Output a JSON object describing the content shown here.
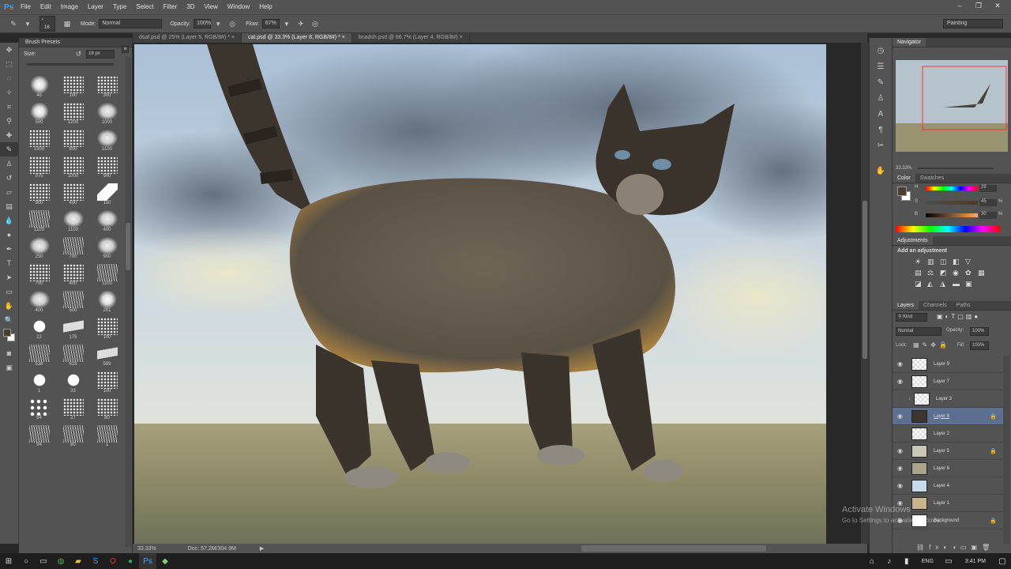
{
  "menu": {
    "logo": "Ps",
    "items": [
      "File",
      "Edit",
      "Image",
      "Layer",
      "Type",
      "Select",
      "Filter",
      "3D",
      "View",
      "Window",
      "Help"
    ]
  },
  "options": {
    "brush_size": "16",
    "mode_label": "Mode:",
    "mode_value": "Normal",
    "opacity_label": "Opacity:",
    "opacity_value": "100%",
    "flow_label": "Flow:",
    "flow_value": "67%",
    "workspace": "Painting"
  },
  "tabs": [
    {
      "label": "dsaf.psd @ 25% (Layer 5, RGB/8#) *"
    },
    {
      "label": "cat.psd @ 33.3% (Layer 8, RGB/8#) *"
    },
    {
      "label": "bnadsh.psd @ 66.7% (Layer 4, RGB/8#)"
    }
  ],
  "brush_presets": {
    "title": "Brush Presets",
    "size_label": "Size:",
    "size_value": "16 px",
    "sizes": [
      "48",
      "100",
      "300",
      "500",
      "1200",
      "1000",
      "1300",
      "800",
      "1100",
      "975",
      "1000",
      "900",
      "900",
      "400",
      "150",
      "1100",
      "1100",
      "400",
      "250",
      "700",
      "900",
      "700",
      "400",
      "1100",
      "400",
      "500",
      "201",
      "22",
      "175",
      "100",
      "538",
      "618",
      "589",
      "1",
      "33",
      "100",
      "54",
      "27",
      "80",
      "94",
      "80",
      "1"
    ]
  },
  "status": {
    "zoom": "33.33%",
    "doc": "Doc: 57.2M/304.9M"
  },
  "navigator": {
    "title": "Navigator",
    "zoom": "33.33%"
  },
  "color": {
    "tabs": [
      "Color",
      "Swatches"
    ],
    "h_label": "H",
    "h_value": "29",
    "s_label": "S",
    "s_value": "45",
    "b_label": "B",
    "b_value": "30",
    "percent": "%",
    "foreground": "#4a3e30",
    "background": "#ffffff"
  },
  "adjustments": {
    "tab": "Adjustments",
    "add_label": "Add an adjustment"
  },
  "layers_panel": {
    "tabs": [
      "Layers",
      "Channels",
      "Paths"
    ],
    "filter": "Kind",
    "blend": "Normal",
    "opacity_label": "Opacity:",
    "opacity_value": "100%",
    "lock_label": "Lock:",
    "fill_label": "Fill:",
    "fill_value": "100%",
    "layers": [
      {
        "name": "Layer 9"
      },
      {
        "name": "Layer 7"
      },
      {
        "name": "Layer 3"
      },
      {
        "name": "Layer 8"
      },
      {
        "name": "Layer 2"
      },
      {
        "name": "Layer 5"
      },
      {
        "name": "Layer 6"
      },
      {
        "name": "Layer 4"
      },
      {
        "name": "Layer 1"
      },
      {
        "name": "Background"
      }
    ]
  },
  "watermark": {
    "line1": "Activate Windows",
    "line2": "Go to Settings to activate Windows."
  },
  "taskbar": {
    "lang": "ENG",
    "time": "3:41 PM"
  }
}
